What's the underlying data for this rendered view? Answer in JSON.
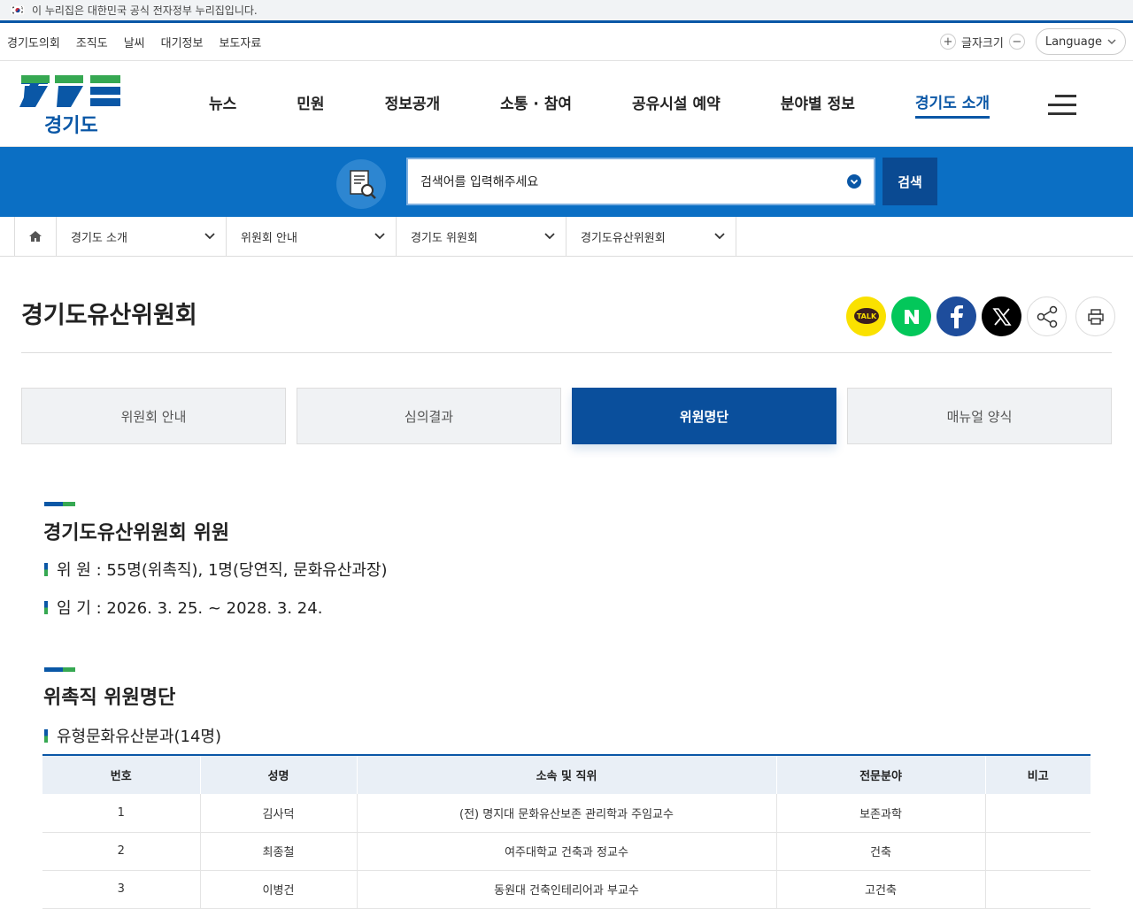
{
  "gov_banner": {
    "text": "이 누리집은 대한민국 공식 전자정부 누리집입니다."
  },
  "util": {
    "links": [
      "경기도의회",
      "조직도",
      "날씨",
      "대기정보",
      "보도자료"
    ],
    "font_size_label": "글자크기",
    "language_label": "Language"
  },
  "header": {
    "logo_text": "경기도",
    "nav": [
      "뉴스",
      "민원",
      "정보공개",
      "소통 · 참여",
      "공유시설 예약",
      "분야별 정보",
      "경기도 소개"
    ],
    "active_nav": "경기도 소개"
  },
  "search": {
    "placeholder": "검색어를 입력해주세요",
    "button": "검색"
  },
  "breadcrumb": [
    "경기도 소개",
    "위원회 안내",
    "경기도 위원회",
    "경기도유산위원회"
  ],
  "page_title": "경기도유산위원회",
  "share": [
    "kakaotalk-icon",
    "naver-icon",
    "facebook-icon",
    "x-icon",
    "share-icon",
    "print-icon"
  ],
  "kakao_label": "TALK",
  "tabs": [
    "위원회 안내",
    "심의결과",
    "위원명단",
    "매뉴얼 양식"
  ],
  "active_tab": "위원명단",
  "section1": {
    "title": "경기도유산위원회 위원",
    "lines": [
      "위 원 : 55명(위촉직), 1명(당연직, 문화유산과장)",
      "임 기 : 2026. 3. 25. ~ 2028. 3. 24."
    ]
  },
  "section2": {
    "title": "위촉직 위원명단",
    "subtitle": "유형문화유산분과(14명)"
  },
  "table": {
    "headers": [
      "번호",
      "성명",
      "소속 및 직위",
      "전문분야",
      "비고"
    ],
    "rows": [
      [
        "1",
        "김사덕",
        "(전) 명지대 문화유산보존 관리학과 주임교수",
        "보존과학",
        ""
      ],
      [
        "2",
        "최종철",
        "여주대학교 건축과 정교수",
        "건축",
        ""
      ],
      [
        "3",
        "이병건",
        "동원대 건축인테리어과 부교수",
        "고건축",
        ""
      ]
    ]
  },
  "colors": {
    "primary": "#0a57a6",
    "search_bg": "#0b6fc4",
    "tab_active": "#0a4f9c",
    "green": "#36a852"
  }
}
